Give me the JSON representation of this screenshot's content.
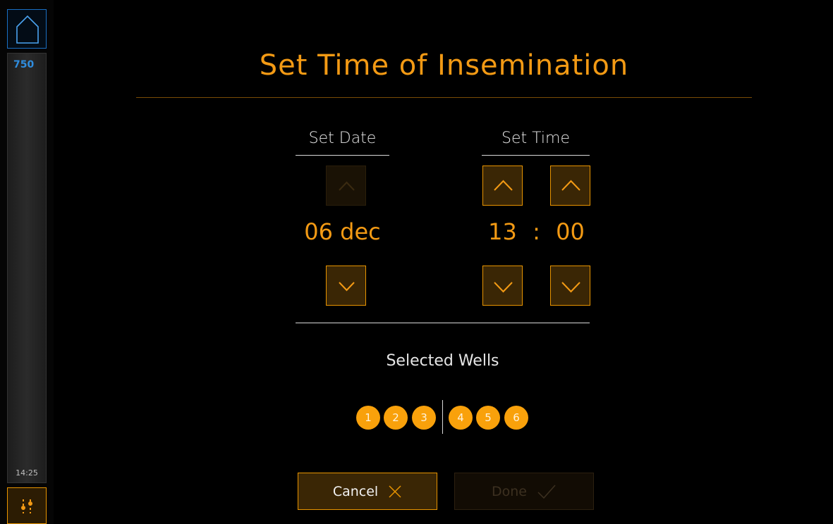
{
  "sidebar": {
    "home_icon": "home-icon",
    "embryo_count": "750",
    "clock": "14:25",
    "settings_icon": "sliders-icon"
  },
  "title": "Set Time of Insemination",
  "date": {
    "header": "Set Date",
    "value": "06 dec",
    "up_icon": "chevron-up-icon",
    "down_icon": "chevron-down-icon"
  },
  "time": {
    "header": "Set Time",
    "hour": "13",
    "separator": ":",
    "minute": "00"
  },
  "wells": {
    "label": "Selected Wells",
    "items": [
      "1",
      "2",
      "3",
      "4",
      "5",
      "6"
    ]
  },
  "actions": {
    "cancel_label": "Cancel",
    "cancel_icon": "close-icon",
    "done_label": "Done",
    "done_icon": "checkmark-icon"
  },
  "colors": {
    "accent": "#f39a14",
    "well": "#f9a10b",
    "home_border": "#1a6fc3",
    "count": "#2f8ddf"
  }
}
